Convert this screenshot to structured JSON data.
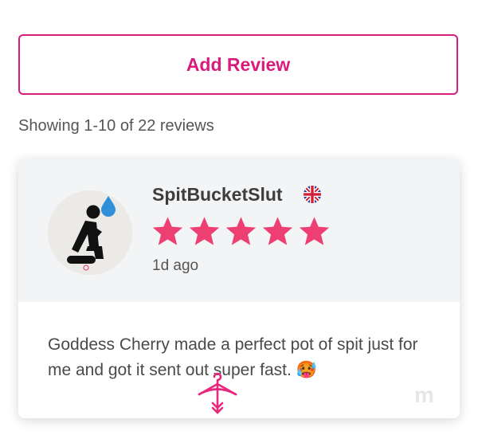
{
  "add_review": {
    "label": "Add Review"
  },
  "pagination": {
    "summary": "Showing 1-10 of 22 reviews"
  },
  "review": {
    "username": "SpitBucketSlut",
    "country_flag": "uk-flag-icon",
    "rating": 5,
    "max_rating": 5,
    "time_ago": "1d ago",
    "text": "Goddess Cherry made a perfect pot of spit just for me and got it sent out super fast. 🥵",
    "avatar_icon": "kneeling-figure-droplet-icon"
  },
  "colors": {
    "accent": "#d81b7d",
    "star": "#ee3f72",
    "card_header_bg": "#f3f4f6"
  },
  "watermark_icon": "bow-hanger-logo-icon"
}
